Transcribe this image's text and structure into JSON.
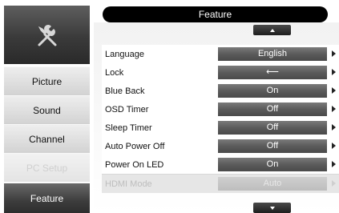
{
  "header": {
    "title": "Feature"
  },
  "logo": {
    "icon": "tools-icon"
  },
  "sidebar": {
    "items": [
      {
        "label": "Picture",
        "state": "normal"
      },
      {
        "label": "Sound",
        "state": "normal"
      },
      {
        "label": "Channel",
        "state": "normal"
      },
      {
        "label": "PC Setup",
        "state": "disabled"
      },
      {
        "label": "Feature",
        "state": "active"
      }
    ]
  },
  "settings": {
    "rows": [
      {
        "label": "Language",
        "value": "English"
      },
      {
        "label": "Lock",
        "value": "⟵",
        "value_icon": "enter-icon"
      },
      {
        "label": "Blue Back",
        "value": "On"
      },
      {
        "label": "OSD Timer",
        "value": "Off"
      },
      {
        "label": "Sleep Timer",
        "value": "Off"
      },
      {
        "label": "Auto Power Off",
        "value": "Off"
      },
      {
        "label": "Power On LED",
        "value": "On"
      },
      {
        "label": "HDMI Mode",
        "value": "Auto",
        "disabled": true
      }
    ]
  },
  "icons": {
    "scroll_up": "up-arrow-icon",
    "scroll_down": "down-arrow-icon",
    "row_arrow": "right-arrow-icon"
  }
}
